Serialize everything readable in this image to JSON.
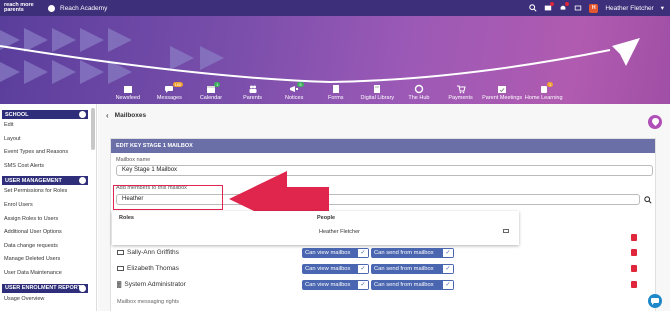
{
  "topbar": {
    "logo_line1": "reach more",
    "logo_line2": "parents",
    "school_name": "Reach Academy",
    "user_initial": "H",
    "user_name": "Heather Fletcher"
  },
  "nav": [
    {
      "label": "Newsfeed",
      "icon": "newspaper-icon"
    },
    {
      "label": "Messages",
      "icon": "chat-icon",
      "badge": "100"
    },
    {
      "label": "Calendar",
      "icon": "calendar-icon",
      "badge": "1"
    },
    {
      "label": "Parents",
      "icon": "people-icon"
    },
    {
      "label": "Notices",
      "icon": "megaphone-icon",
      "badge": "5"
    },
    {
      "label": "Forms",
      "icon": "form-icon"
    },
    {
      "label": "Digital Library",
      "icon": "book-icon"
    },
    {
      "label": "The Hub",
      "icon": "hub-icon"
    },
    {
      "label": "Payments",
      "icon": "cart-icon"
    },
    {
      "label": "Parent Meetings",
      "icon": "meeting-icon"
    },
    {
      "label": "Home Learning",
      "icon": "backpack-icon",
      "badge": "1"
    }
  ],
  "sidebar": {
    "sections": [
      {
        "title": "SCHOOL",
        "items": [
          "Edit",
          "Layout",
          "Event Types and Reasons",
          "SMS Cost Alerts"
        ]
      },
      {
        "title": "USER MANAGEMENT",
        "items": [
          "Set Permissions for Roles",
          "Enrol Users",
          "Assign Roles to Users",
          "Additional User Options",
          "Data change requests",
          "Manage Deleted Users",
          "User Data Maintenance"
        ]
      },
      {
        "title": "USER ENROLMENT REPORTS",
        "items": [
          "Usage Overview"
        ]
      }
    ]
  },
  "main": {
    "breadcrumb": "Mailboxes",
    "panel_title": "EDIT KEY STAGE 1 MAILBOX",
    "mailbox_name_label": "Mailbox name",
    "mailbox_name_value": "Key Stage 1 Mailbox",
    "add_members_label": "Add members to this mailbox",
    "add_members_value": "Heather",
    "dropdown": {
      "roles_header": "Roles",
      "people_header": "People",
      "person": "Heather Fletcher"
    },
    "members": [
      {
        "name": "Sally-Ann Griffiths",
        "icon": "id-card-icon",
        "view": "Can view mailbox",
        "send": "Can send from mailbox"
      },
      {
        "name": "Elizabeth Thomas",
        "icon": "id-card-icon",
        "view": "Can view mailbox",
        "send": "Can send from mailbox"
      },
      {
        "name": "System Administrator",
        "icon": "group-icon",
        "view": "Can view mailbox",
        "send": "Can send from mailbox"
      }
    ],
    "messaging_rights_label": "Mailbox messaging rights"
  },
  "colors": {
    "topbar": "#3d2f7a",
    "sidebar_header": "#2e2e7a",
    "panel_header": "#6a6fa8",
    "permission": "#4a66b0",
    "delete": "#e0263b",
    "annotation": "#e0264c"
  }
}
